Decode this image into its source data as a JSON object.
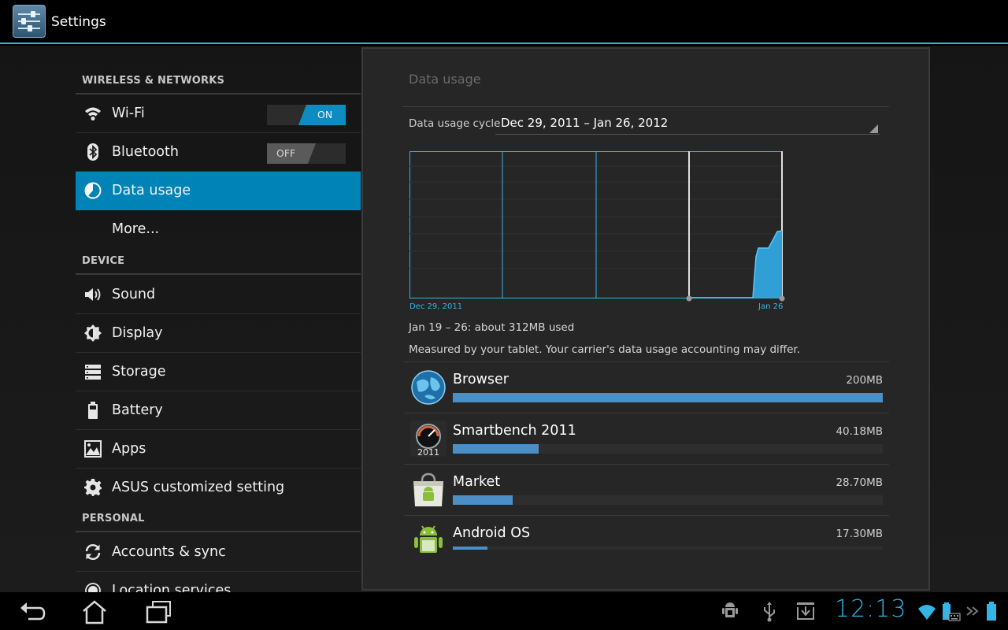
{
  "app": {
    "title": "Settings"
  },
  "sidebar": {
    "sections": [
      {
        "header": "WIRELESS & NETWORKS",
        "items": [
          {
            "label": "Wi-Fi",
            "icon": "wifi-icon",
            "toggle": "ON"
          },
          {
            "label": "Bluetooth",
            "icon": "bluetooth-icon",
            "toggle": "OFF"
          },
          {
            "label": "Data usage",
            "icon": "data-usage-icon",
            "selected": true
          },
          {
            "label": "More...",
            "icon": ""
          }
        ]
      },
      {
        "header": "DEVICE",
        "items": [
          {
            "label": "Sound",
            "icon": "speaker-icon"
          },
          {
            "label": "Display",
            "icon": "brightness-icon"
          },
          {
            "label": "Storage",
            "icon": "storage-icon"
          },
          {
            "label": "Battery",
            "icon": "battery-icon"
          },
          {
            "label": "Apps",
            "icon": "apps-icon"
          },
          {
            "label": "ASUS customized setting",
            "icon": "gear-icon"
          }
        ]
      },
      {
        "header": "PERSONAL",
        "items": [
          {
            "label": "Accounts & sync",
            "icon": "sync-icon"
          },
          {
            "label": "Location services",
            "icon": "location-icon"
          }
        ]
      }
    ]
  },
  "panel": {
    "title": "Data usage",
    "cycle_label": "Data usage cycle",
    "cycle_value": "Dec 29, 2011 – Jan 26, 2012",
    "chart_start_label": "Dec 29, 2011",
    "chart_end_label": "Jan 26",
    "summary": "Jan 19 – 26: about 312MB used",
    "disclaimer": "Measured by your tablet. Your carrier's data usage accounting may differ.",
    "apps": [
      {
        "name": "Browser",
        "size": "200MB",
        "fraction": 1.0,
        "icon": "browser-globe-icon"
      },
      {
        "name": "Smartbench 2011",
        "size": "40.18MB",
        "fraction": 0.2,
        "icon": "smartbench-icon"
      },
      {
        "name": "Market",
        "size": "28.70MB",
        "fraction": 0.14,
        "icon": "market-bag-icon"
      },
      {
        "name": "Android OS",
        "size": "17.30MB",
        "fraction": 0.08,
        "icon": "android-icon"
      }
    ]
  },
  "system_bar": {
    "clock": "12:13"
  },
  "colors": {
    "accent": "#33b5e5",
    "selected": "#0083b6",
    "bar": "#4b8fc6"
  }
}
